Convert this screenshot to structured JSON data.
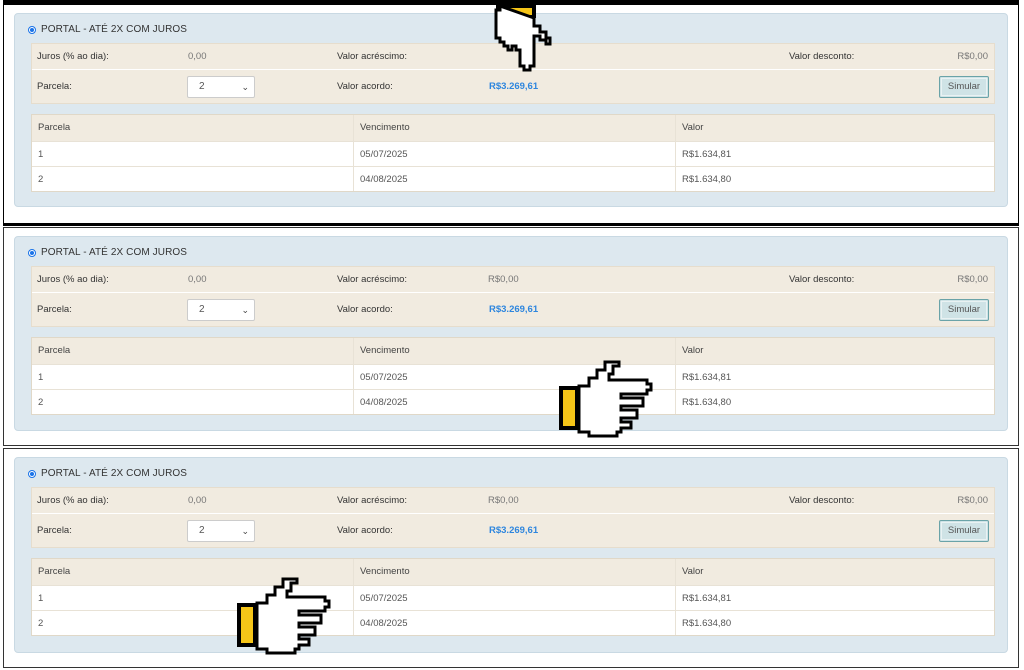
{
  "panels": [
    {
      "option_label": "PORTAL - ATÉ 2X COM JUROS",
      "juros_label": "Juros (% ao dia):",
      "juros_value": "0,00",
      "acrescimo_label": "Valor acréscimo:",
      "acrescimo_value": "",
      "desconto_label": "Valor desconto:",
      "desconto_value": "R$0,00",
      "parcela_label": "Parcela:",
      "parcela_selected": "2",
      "acordo_label": "Valor acordo:",
      "acordo_value": "R$3.269,61",
      "simular_label": "Simular",
      "table": {
        "headers": [
          "Parcela",
          "Vencimento",
          "Valor"
        ],
        "rows": [
          [
            "1",
            "05/07/2025",
            "R$1.634,81"
          ],
          [
            "2",
            "04/08/2025",
            "R$1.634,80"
          ]
        ]
      }
    },
    {
      "option_label": "PORTAL - ATÉ 2X COM JUROS",
      "juros_label": "Juros (% ao dia):",
      "juros_value": "0,00",
      "acrescimo_label": "Valor acréscimo:",
      "acrescimo_value": "R$0,00",
      "desconto_label": "Valor desconto:",
      "desconto_value": "R$0,00",
      "parcela_label": "Parcela:",
      "parcela_selected": "2",
      "acordo_label": "Valor acordo:",
      "acordo_value": "R$3.269,61",
      "simular_label": "Simular",
      "table": {
        "headers": [
          "Parcela",
          "Vencimento",
          "Valor"
        ],
        "rows": [
          [
            "1",
            "05/07/2025",
            "R$1.634,81"
          ],
          [
            "2",
            "04/08/2025",
            "R$1.634,80"
          ]
        ]
      }
    },
    {
      "option_label": "PORTAL - ATÉ 2X COM JUROS",
      "juros_label": "Juros (% ao dia):",
      "juros_value": "0,00",
      "acrescimo_label": "Valor acréscimo:",
      "acrescimo_value": "R$0,00",
      "desconto_label": "Valor desconto:",
      "desconto_value": "R$0,00",
      "parcela_label": "Parcela:",
      "parcela_selected": "2",
      "acordo_label": "Valor acordo:",
      "acordo_value": "R$3.269,61",
      "simular_label": "Simular",
      "table": {
        "headers": [
          "Parcela",
          "Vencimento",
          "Valor"
        ],
        "rows": [
          [
            "1",
            "05/07/2025",
            "R$1.634,81"
          ],
          [
            "2",
            "04/08/2025",
            "R$1.634,80"
          ]
        ]
      }
    }
  ],
  "icons": {
    "select_chevron": "chevron-down-icon",
    "pointer": "pointing-hand-cursor-icon",
    "cuff_color": "#f5c518",
    "accent_color": "#2e86de"
  }
}
